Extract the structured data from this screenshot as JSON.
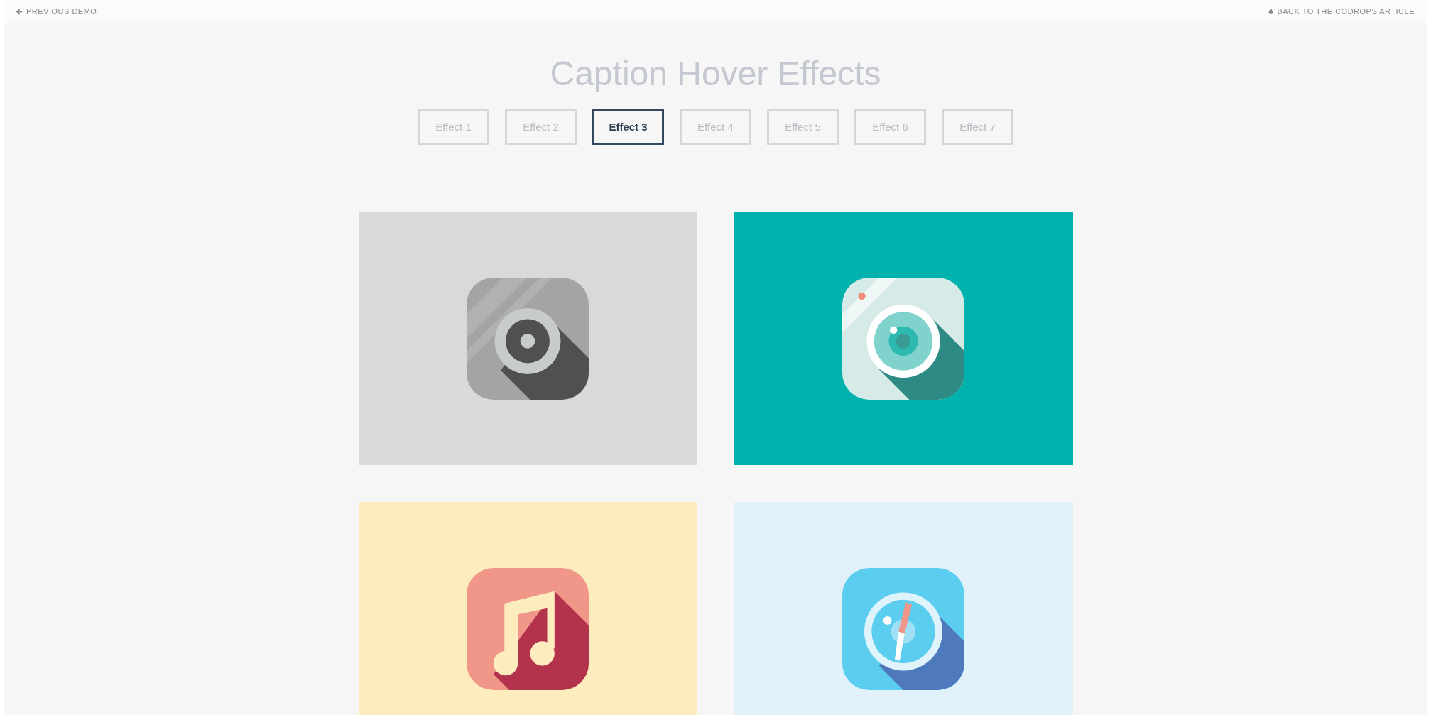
{
  "top_bar": {
    "left_link": "PREVIOUS DEMO",
    "right_link": "BACK TO THE CODROPS ARTICLE"
  },
  "title": "Caption Hover Effects",
  "tabs": [
    {
      "label": "Effect 1",
      "selected": false
    },
    {
      "label": "Effect 2",
      "selected": false
    },
    {
      "label": "Effect 3",
      "selected": true
    },
    {
      "label": "Effect 4",
      "selected": false
    },
    {
      "label": "Effect 5",
      "selected": false
    },
    {
      "label": "Effect 6",
      "selected": false
    },
    {
      "label": "Effect 7",
      "selected": false
    }
  ],
  "grid": [
    {
      "kind": "gear",
      "color": "#d7d9da"
    },
    {
      "kind": "camera",
      "color": "#00b2ae"
    },
    {
      "kind": "music",
      "color": "#fdecbd"
    },
    {
      "kind": "compass",
      "color": "#e1f1fa"
    }
  ]
}
